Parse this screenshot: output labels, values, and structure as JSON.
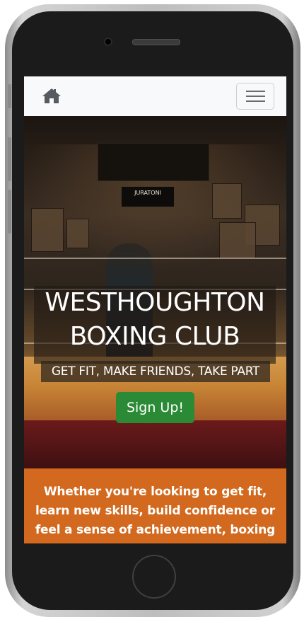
{
  "nav": {
    "home_icon": "home-icon",
    "menu_icon": "hamburger-menu-icon"
  },
  "hero": {
    "title_line1": "WESTHOUGHTON",
    "title_line2": "BOXING CLUB",
    "tagline": "GET FIT, MAKE FRIENDS, TAKE PART",
    "cta_label": "Sign Up!",
    "photo_texts": [
      "JURATONI"
    ]
  },
  "intro": {
    "text": "Whether you're looking to get fit, learn new skills, build confidence or feel a sense of achievement, boxing"
  },
  "colors": {
    "navbar_bg": "#f8f9fa",
    "cta_green": "#2b8a35",
    "intro_orange": "#d2691e",
    "text_white": "#ffffff"
  }
}
